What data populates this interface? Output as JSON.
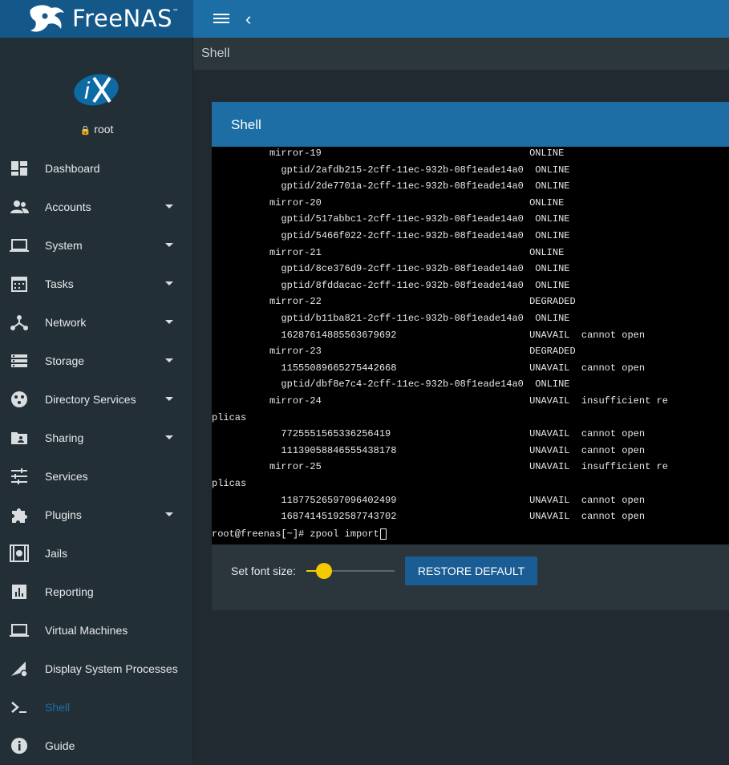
{
  "brand": {
    "name": "FreeNAS",
    "tm": "™"
  },
  "user": {
    "name": "root"
  },
  "breadcrumb": "Shell",
  "card": {
    "title": "Shell"
  },
  "nav": [
    {
      "label": "Dashboard",
      "icon": "dashboard-icon",
      "caret": false
    },
    {
      "label": "Accounts",
      "icon": "accounts-icon",
      "caret": true
    },
    {
      "label": "System",
      "icon": "laptop-icon",
      "caret": true
    },
    {
      "label": "Tasks",
      "icon": "calendar-icon",
      "caret": true
    },
    {
      "label": "Network",
      "icon": "network-icon",
      "caret": true
    },
    {
      "label": "Storage",
      "icon": "storage-icon",
      "caret": true
    },
    {
      "label": "Directory Services",
      "icon": "directory-icon",
      "caret": true
    },
    {
      "label": "Sharing",
      "icon": "folder-share-icon",
      "caret": true
    },
    {
      "label": "Services",
      "icon": "tune-icon",
      "caret": false
    },
    {
      "label": "Plugins",
      "icon": "puzzle-icon",
      "caret": true
    },
    {
      "label": "Jails",
      "icon": "jail-icon",
      "caret": false
    },
    {
      "label": "Reporting",
      "icon": "chart-icon",
      "caret": false
    },
    {
      "label": "Virtual Machines",
      "icon": "laptop-icon",
      "caret": false
    },
    {
      "label": "Display System Processes",
      "icon": "processes-icon",
      "caret": false
    },
    {
      "label": "Shell",
      "icon": "terminal-icon",
      "caret": false,
      "active": true
    },
    {
      "label": "Guide",
      "icon": "info-icon",
      "caret": false
    }
  ],
  "terminal_lines": [
    "          mirror-19                                    ONLINE",
    "            gptid/2afdb215-2cff-11ec-932b-08f1eade14a0  ONLINE",
    "            gptid/2de7701a-2cff-11ec-932b-08f1eade14a0  ONLINE",
    "          mirror-20                                    ONLINE",
    "            gptid/517abbc1-2cff-11ec-932b-08f1eade14a0  ONLINE",
    "            gptid/5466f022-2cff-11ec-932b-08f1eade14a0  ONLINE",
    "          mirror-21                                    ONLINE",
    "            gptid/8ce376d9-2cff-11ec-932b-08f1eade14a0  ONLINE",
    "            gptid/8fddacac-2cff-11ec-932b-08f1eade14a0  ONLINE",
    "          mirror-22                                    DEGRADED",
    "            gptid/b11ba821-2cff-11ec-932b-08f1eade14a0  ONLINE",
    "            16287614885563679692                       UNAVAIL  cannot open",
    "          mirror-23                                    DEGRADED",
    "            11555089665275442668                       UNAVAIL  cannot open",
    "            gptid/dbf8e7c4-2cff-11ec-932b-08f1eade14a0  ONLINE",
    "          mirror-24                                    UNAVAIL  insufficient re",
    "plicas",
    "            7725551565336256419                        UNAVAIL  cannot open",
    "            11139058846555438178                       UNAVAIL  cannot open",
    "          mirror-25                                    UNAVAIL  insufficient re",
    "plicas",
    "            11877526597096402499                       UNAVAIL  cannot open",
    "            16874145192587743702                       UNAVAIL  cannot open"
  ],
  "prompt": "root@freenas[~]# zpool import",
  "controls": {
    "font_label": "Set font size:",
    "restore_label": "RESTORE DEFAULT",
    "font_size_level": 0.2
  },
  "colors": {
    "topbar": "#1c6ea4",
    "accent": "#f4c900",
    "sidebar": "#232f37"
  }
}
